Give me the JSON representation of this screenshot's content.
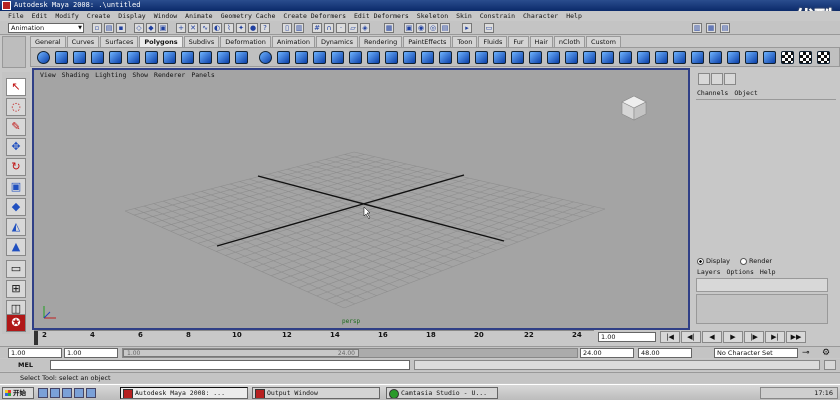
{
  "window": {
    "title": "Autodesk Maya 2008: .\\untitled"
  },
  "watermark": "优酷",
  "menu": [
    "File",
    "Edit",
    "Modify",
    "Create",
    "Display",
    "Window",
    "Animate",
    "Geometry Cache",
    "Create Deformers",
    "Edit Deformers",
    "Skeleton",
    "Skin",
    "Constrain",
    "Character",
    "Help"
  ],
  "statusline": {
    "mode": "Animation"
  },
  "shelf_tabs": {
    "active": "Polygons",
    "items": [
      "General",
      "Curves",
      "Surfaces",
      "Polygons",
      "Subdivs",
      "Deformation",
      "Animation",
      "Dynamics",
      "Rendering",
      "PaintEffects",
      "Toon",
      "Fluids",
      "Fur",
      "Hair",
      "nCloth",
      "Custom"
    ]
  },
  "panel_menu": [
    "View",
    "Shading",
    "Lighting",
    "Show",
    "Renderer",
    "Panels"
  ],
  "viewport": {
    "camera": "persp"
  },
  "right_panel": {
    "menu": [
      "Channels",
      "Object"
    ],
    "layer_mode": {
      "display": "Display",
      "render": "Render",
      "selected": "display"
    },
    "layer_menu": [
      "Layers",
      "Options",
      "Help"
    ]
  },
  "timeline": {
    "ticks": [
      "2",
      "4",
      "6",
      "8",
      "10",
      "12",
      "14",
      "16",
      "18",
      "20",
      "22",
      "24"
    ],
    "current_label": "1",
    "current_field": "1.00"
  },
  "range": {
    "start": "1.00",
    "sub_start": "1.00",
    "handle_start": "1.00",
    "handle_end": "24.00",
    "end": "24.00",
    "anim_end": "48.00",
    "character_set": "No Character Set"
  },
  "command_line": {
    "label": "MEL"
  },
  "help_line": "Select Tool: select an object",
  "taskbar": {
    "start": "开始",
    "tasks": [
      "Autodesk Maya 2008: ...",
      "Output Window",
      "Camtasia Studio - U..."
    ],
    "clock": "17:16"
  },
  "colors": {
    "title_bar": "#0b2a6a",
    "viewport_bg": "#a4a4a4",
    "viewport_border": "#2f3f86",
    "grid_line": "#8e8e8e",
    "axis_line": "#111111"
  }
}
